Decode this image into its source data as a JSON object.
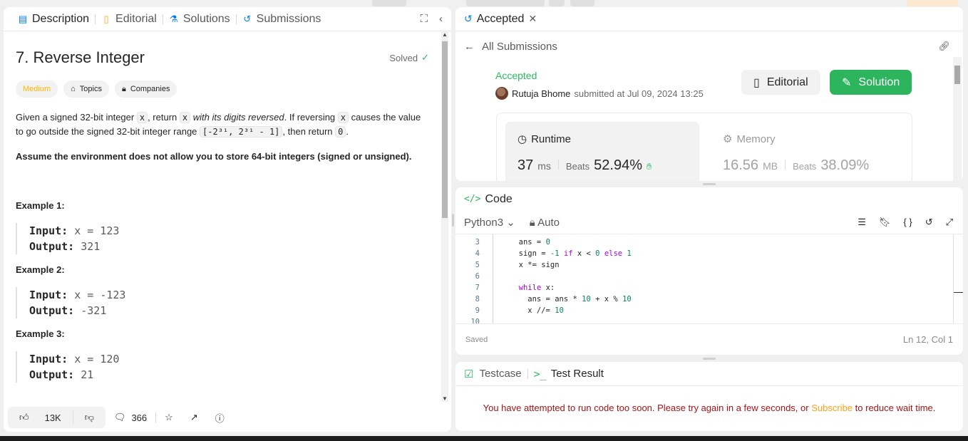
{
  "left_tabs": [
    "Description",
    "Editorial",
    "Solutions",
    "Submissions"
  ],
  "problem": {
    "title": "7. Reverse Integer",
    "solved": "Solved",
    "difficulty": "Medium",
    "topics": "Topics",
    "companies": "Companies",
    "desc_p1": "Given a signed 32-bit integer",
    "desc_x": "x",
    "desc_p2": ", return",
    "desc_p3": "with its digits reversed",
    "desc_p4": ". If reversing",
    "desc_p5": "causes the value to go outside the signed 32-bit integer range",
    "desc_range": "[-2³¹, 2³¹ - 1]",
    "desc_p6": ", then return",
    "desc_zero": "0",
    "desc_p7": ".",
    "assume": "Assume the environment does not allow you to store 64-bit integers (signed or unsigned).",
    "examples": [
      {
        "label": "Example 1:",
        "input_label": "Input:",
        "input": "x = 123",
        "output_label": "Output:",
        "output": "321"
      },
      {
        "label": "Example 2:",
        "input_label": "Input:",
        "input": "x = -123",
        "output_label": "Output:",
        "output": "-321"
      },
      {
        "label": "Example 3:",
        "input_label": "Input:",
        "input": "x = 120",
        "output_label": "Output:",
        "output": "21"
      }
    ]
  },
  "footer": {
    "likes": "13K",
    "comments": "366"
  },
  "submission": {
    "tab": "Accepted",
    "all_submissions": "All Submissions",
    "status": "Accepted",
    "user": "Rutuja Bhome",
    "submitted": "submitted at Jul 09, 2024 13:25",
    "editorial_btn": "Editorial",
    "solution_btn": "Solution",
    "runtime_label": "Runtime",
    "runtime_value": "37",
    "runtime_unit": "ms",
    "runtime_beats_label": "Beats",
    "runtime_beats": "52.94%",
    "memory_label": "Memory",
    "memory_value": "16.56",
    "memory_unit": "MB",
    "memory_beats_label": "Beats",
    "memory_beats": "38.09%"
  },
  "code": {
    "header": "Code",
    "language": "Python3",
    "mode": "Auto",
    "lines": [
      {
        "n": "3",
        "html": "  ans = <span class=\"num\">0</span>"
      },
      {
        "n": "4",
        "html": "  sign = <span class=\"num\">-1</span> <span class=\"kw\">if</span> x &lt; <span class=\"num\">0</span> <span class=\"kw\">else</span> <span class=\"num\">1</span>"
      },
      {
        "n": "5",
        "html": "  x *= sign"
      },
      {
        "n": "6",
        "html": ""
      },
      {
        "n": "7",
        "html": "  <span class=\"kw\">while</span> x:"
      },
      {
        "n": "8",
        "html": "    ans = ans * <span class=\"num\">10</span> + x % <span class=\"num\">10</span>"
      },
      {
        "n": "9",
        "html": "    x //= <span class=\"num\">10</span>"
      },
      {
        "n": "10",
        "html": ""
      }
    ],
    "saved": "Saved",
    "position": "Ln 12, Col 1"
  },
  "test": {
    "tab_testcase": "Testcase",
    "tab_result": "Test Result",
    "msg_before": "You have attempted to run code too soon. Please try again in a few seconds, or",
    "msg_link": "Subscribe",
    "msg_after": "to reduce wait time."
  },
  "colors": {
    "accent_green": "#2cbb5d",
    "medium": "#ffb800",
    "error": "#a31515",
    "link_orange": "#ffa116"
  }
}
